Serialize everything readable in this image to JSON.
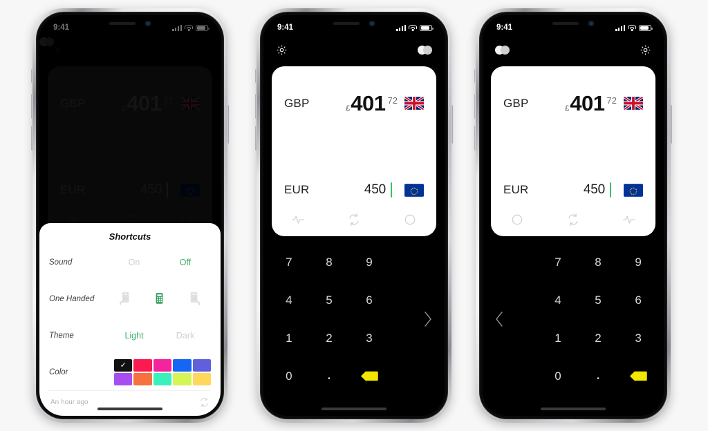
{
  "status_bar": {
    "time": "9:41",
    "signal_icon": "signal-bars-icon",
    "wifi_icon": "wifi-icon",
    "battery_icon": "battery-icon"
  },
  "app": {
    "gear_icon": "gear-icon",
    "dots_icon": "two-dots-icon",
    "converter": {
      "from": {
        "code": "GBP",
        "symbol": "£",
        "whole": "401",
        "decimals": "72",
        "flag": "uk-flag"
      },
      "to": {
        "code": "EUR",
        "value": "450",
        "flag": "eu-flag"
      }
    },
    "card_icons": [
      "rate-chart-icon",
      "swap-currency-icon",
      "circle-icon"
    ],
    "card_icons_mirrored": [
      "circle-icon",
      "swap-currency-icon",
      "rate-chart-icon"
    ]
  },
  "keypad": {
    "keys": [
      "7",
      "8",
      "9",
      "4",
      "5",
      "6",
      "1",
      "2",
      "3",
      "0",
      ".",
      "backspace-icon"
    ],
    "backspace_label": "backspace-icon",
    "handle_right_icon": "chevron-right-icon",
    "handle_left_icon": "chevron-left-icon",
    "backspace_color": "#f3e600"
  },
  "shortcuts": {
    "title": "Shortcuts",
    "rows": [
      {
        "label": "Sound",
        "options": [
          {
            "text": "On",
            "active": false
          },
          {
            "text": "Off",
            "active": true
          }
        ]
      },
      {
        "label": "One Handed",
        "options": [
          {
            "text": "calculator-left-icon",
            "active": false
          },
          {
            "text": "calculator-center-icon",
            "active": true
          },
          {
            "text": "calculator-right-icon",
            "active": false
          }
        ]
      },
      {
        "label": "Theme",
        "options": [
          {
            "text": "Light",
            "active": true
          },
          {
            "text": "Dark",
            "active": false
          }
        ]
      },
      {
        "label": "Color",
        "options": []
      }
    ],
    "colors": [
      {
        "hex": "#111111",
        "selected": true
      },
      {
        "hex": "#fa1b51",
        "selected": false
      },
      {
        "hex": "#f5239e",
        "selected": false
      },
      {
        "hex": "#1566f5",
        "selected": false
      },
      {
        "hex": "#6060dd",
        "selected": false
      },
      {
        "hex": "#a84ef0",
        "selected": false
      },
      {
        "hex": "#f5713f",
        "selected": false
      },
      {
        "hex": "#3af0bb",
        "selected": false
      },
      {
        "hex": "#d5f557",
        "selected": false
      },
      {
        "hex": "#ffd75c",
        "selected": false
      }
    ],
    "selected_check": "✓",
    "footer": {
      "timestamp": "An hour ago",
      "refresh_icon": "refresh-icon"
    }
  },
  "accent_green": "#41b06a"
}
